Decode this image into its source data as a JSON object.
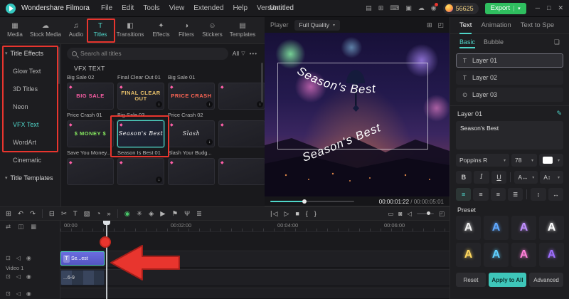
{
  "glyphs": {
    "chevron_down": "▾",
    "diamond_gem": "◆",
    "download": "↓",
    "dots_more": "•••",
    "funnel": "▽",
    "pen": "✎",
    "bookmark": "❏"
  },
  "titlebar": {
    "app_name": "Wondershare Filmora",
    "menus": [
      "File",
      "Edit",
      "Tools",
      "View",
      "Extended",
      "Help",
      "Version"
    ],
    "project_name": "Untitled",
    "icons": [
      {
        "name": "layout-icon",
        "glyph": "▤"
      },
      {
        "name": "plugin-grid-icon",
        "glyph": "⊞"
      },
      {
        "name": "keyboard-icon",
        "glyph": "⌨"
      },
      {
        "name": "clipboard-icon",
        "glyph": "▣"
      },
      {
        "name": "cloud-icon",
        "glyph": "☁"
      },
      {
        "name": "notification-bell-icon",
        "glyph": "◉"
      }
    ],
    "coin_count": "56625",
    "export_label": "Export",
    "window_buttons": [
      {
        "name": "minimize-button",
        "glyph": "─"
      },
      {
        "name": "maximize-button",
        "glyph": "□"
      },
      {
        "name": "close-button",
        "glyph": "✕"
      }
    ]
  },
  "media_tabbar": {
    "tabs": [
      {
        "label": "Media",
        "glyph": "▦"
      },
      {
        "label": "Stock Media",
        "glyph": "☁"
      },
      {
        "label": "Audio",
        "glyph": "♫"
      },
      {
        "label": "Titles",
        "glyph": "T"
      },
      {
        "label": "Transitions",
        "glyph": "◧"
      },
      {
        "label": "Effects",
        "glyph": "✦"
      },
      {
        "label": "Filters",
        "glyph": "◑"
      },
      {
        "label": "Stickers",
        "glyph": "☺"
      },
      {
        "label": "Templates",
        "glyph": "▤"
      }
    ]
  },
  "sidebar": {
    "group_label": "Title Effects",
    "items": [
      "Glow Text",
      "3D Titles",
      "Neon",
      "VFX Text",
      "WordArt",
      "Cinematic"
    ],
    "active_item": "VFX Text",
    "footer_label": "Title Templates"
  },
  "library": {
    "search_placeholder": "Search all titles",
    "filter_label": "All",
    "group_title": "VFX TEXT",
    "label_rows": [
      [
        "Big Sale 02",
        "Final Clear Out 01",
        "Big Sale 01"
      ],
      [
        "Price Crash 01",
        "Big Sale 03",
        "Price Crash 02"
      ],
      [
        "Save You Money...",
        "Season Is Best 01",
        "Slash Your Budg..."
      ]
    ],
    "selected_item": "Season Is Best 01",
    "thumb_rows": [
      [
        {
          "text": "BIG SALE",
          "color": "#ff5fa8"
        },
        {
          "text": "FINAL CLEAR OUT",
          "color": "#e8c06a"
        },
        {
          "text": "PRICE CRASH",
          "color": "#ff6655"
        },
        {
          "text": "",
          "color": "#cccccc"
        }
      ],
      [
        {
          "text": "$ MONEY $",
          "color": "#86e85f"
        },
        {
          "text": "Season's Best",
          "color": "#ffffff"
        },
        {
          "text": "Slash",
          "color": "#e6e6e6"
        },
        {
          "text": "",
          "color": "#ff8fb0"
        }
      ],
      [
        {
          "text": "",
          "color": "#9fd8ff"
        },
        {
          "text": "",
          "color": "#ff9fd0"
        },
        {
          "text": "",
          "color": "#ff6a6a"
        },
        {
          "text": "",
          "color": "#8fb0ff"
        }
      ]
    ]
  },
  "player": {
    "label": "Player",
    "quality_value": "Full Quality",
    "header_icons": [
      {
        "name": "layout-grid-icon",
        "glyph": "⊞"
      },
      {
        "name": "detach-player-icon",
        "glyph": "◰"
      }
    ],
    "preview_text_top": "Season's Best",
    "preview_text_bottom": "Season's Best",
    "current_time": "00:00:01:22",
    "duration": " / 00:00:05:01",
    "transport": [
      {
        "name": "previous-frame-button",
        "glyph": "∣◁"
      },
      {
        "name": "play-button",
        "glyph": "▷"
      },
      {
        "name": "stop-button",
        "glyph": "■"
      },
      {
        "name": "mark-in-button",
        "glyph": "{"
      },
      {
        "name": "mark-out-button",
        "glyph": "}"
      }
    ],
    "right_controls": [
      {
        "name": "display-mode-icon",
        "glyph": "▭"
      },
      {
        "name": "snapshot-camera-icon",
        "glyph": "◙"
      },
      {
        "name": "speaker-icon",
        "glyph": "◁"
      },
      {
        "name": "fullscreen-icon",
        "glyph": "◰"
      }
    ]
  },
  "toolbar": {
    "left": [
      {
        "name": "workspace-icon",
        "glyph": "⊞"
      },
      {
        "name": "undo-icon",
        "glyph": "↶"
      },
      {
        "name": "redo-icon",
        "glyph": "↷"
      },
      {
        "name": "delete-icon",
        "glyph": "⊟"
      },
      {
        "name": "split-scissors-icon",
        "glyph": "✂"
      },
      {
        "name": "text-tool-icon",
        "glyph": "T"
      },
      {
        "name": "crop-icon",
        "glyph": "▧"
      },
      {
        "name": "speed-icon",
        "glyph": "◔"
      },
      {
        "name": "more-tools-icon",
        "glyph": "»"
      }
    ],
    "center": [
      {
        "name": "chroma-key-icon",
        "glyph": "◉"
      },
      {
        "name": "motion-tracking-icon",
        "glyph": "✳"
      },
      {
        "name": "keyframe-icon",
        "glyph": "◈"
      },
      {
        "name": "render-preview-icon",
        "glyph": "▶"
      },
      {
        "name": "marker-icon",
        "glyph": "⚑"
      },
      {
        "name": "voiceover-mic-icon",
        "glyph": "Ψ"
      },
      {
        "name": "audio-mixer-icon",
        "glyph": "≣"
      }
    ]
  },
  "timeline": {
    "rail_icons": [
      {
        "name": "manage-tracks-icon",
        "glyph": "⇄"
      },
      {
        "name": "snap-icon",
        "glyph": "◫"
      },
      {
        "name": "keyframe-rail-icon",
        "glyph": "▦"
      }
    ],
    "ruler_labels": [
      "00:00",
      "00:02:00",
      "00:04:00",
      "00:06:00"
    ],
    "track_controls": [
      {
        "name": "track-lock-icon",
        "glyph": "⊡"
      },
      {
        "name": "track-mute-icon",
        "glyph": "◁"
      },
      {
        "name": "track-visibility-icon",
        "glyph": "◉"
      }
    ],
    "video_track_label": "Video 1",
    "title_clip_badge": "T",
    "title_clip_label": "Se...est",
    "video_clip_label": "...6-9"
  },
  "text_panel": {
    "tabs": [
      "Text",
      "Animation",
      "Text to Spe"
    ],
    "subtabs": [
      "Basic",
      "Bubble"
    ],
    "layers": [
      {
        "label": "Layer 01",
        "glyph": "T"
      },
      {
        "label": "Layer 02",
        "glyph": "T"
      },
      {
        "label": "Layer 03",
        "glyph": "⊙"
      }
    ],
    "section_title": "Layer 01",
    "text_value": "Season's Best",
    "font_name": "Poppins R",
    "font_size": "78",
    "style_buttons": [
      "B",
      "I",
      "U"
    ],
    "spacing_buttons": [
      "A↔",
      "A↕"
    ],
    "align_buttons": [
      "≡",
      "≡",
      "≡",
      "≣"
    ],
    "valign_buttons": [
      "↕",
      "↔"
    ],
    "preset_label": "Preset",
    "presets": [
      {
        "glyph": "A",
        "color": "#f0f0f0"
      },
      {
        "glyph": "A",
        "color": "#5fa8ff"
      },
      {
        "glyph": "A",
        "color": "#c08fff"
      },
      {
        "glyph": "A",
        "color": "#ffffff"
      },
      {
        "glyph": "A",
        "color": "#ffd85f"
      },
      {
        "glyph": "A",
        "color": "#5fd0ff"
      },
      {
        "glyph": "A",
        "color": "#ff7fd8"
      },
      {
        "glyph": "A",
        "color": "#9f6fff"
      }
    ],
    "reset_label": "Reset",
    "apply_label": "Apply to All",
    "advanced_label": "Advanced"
  }
}
